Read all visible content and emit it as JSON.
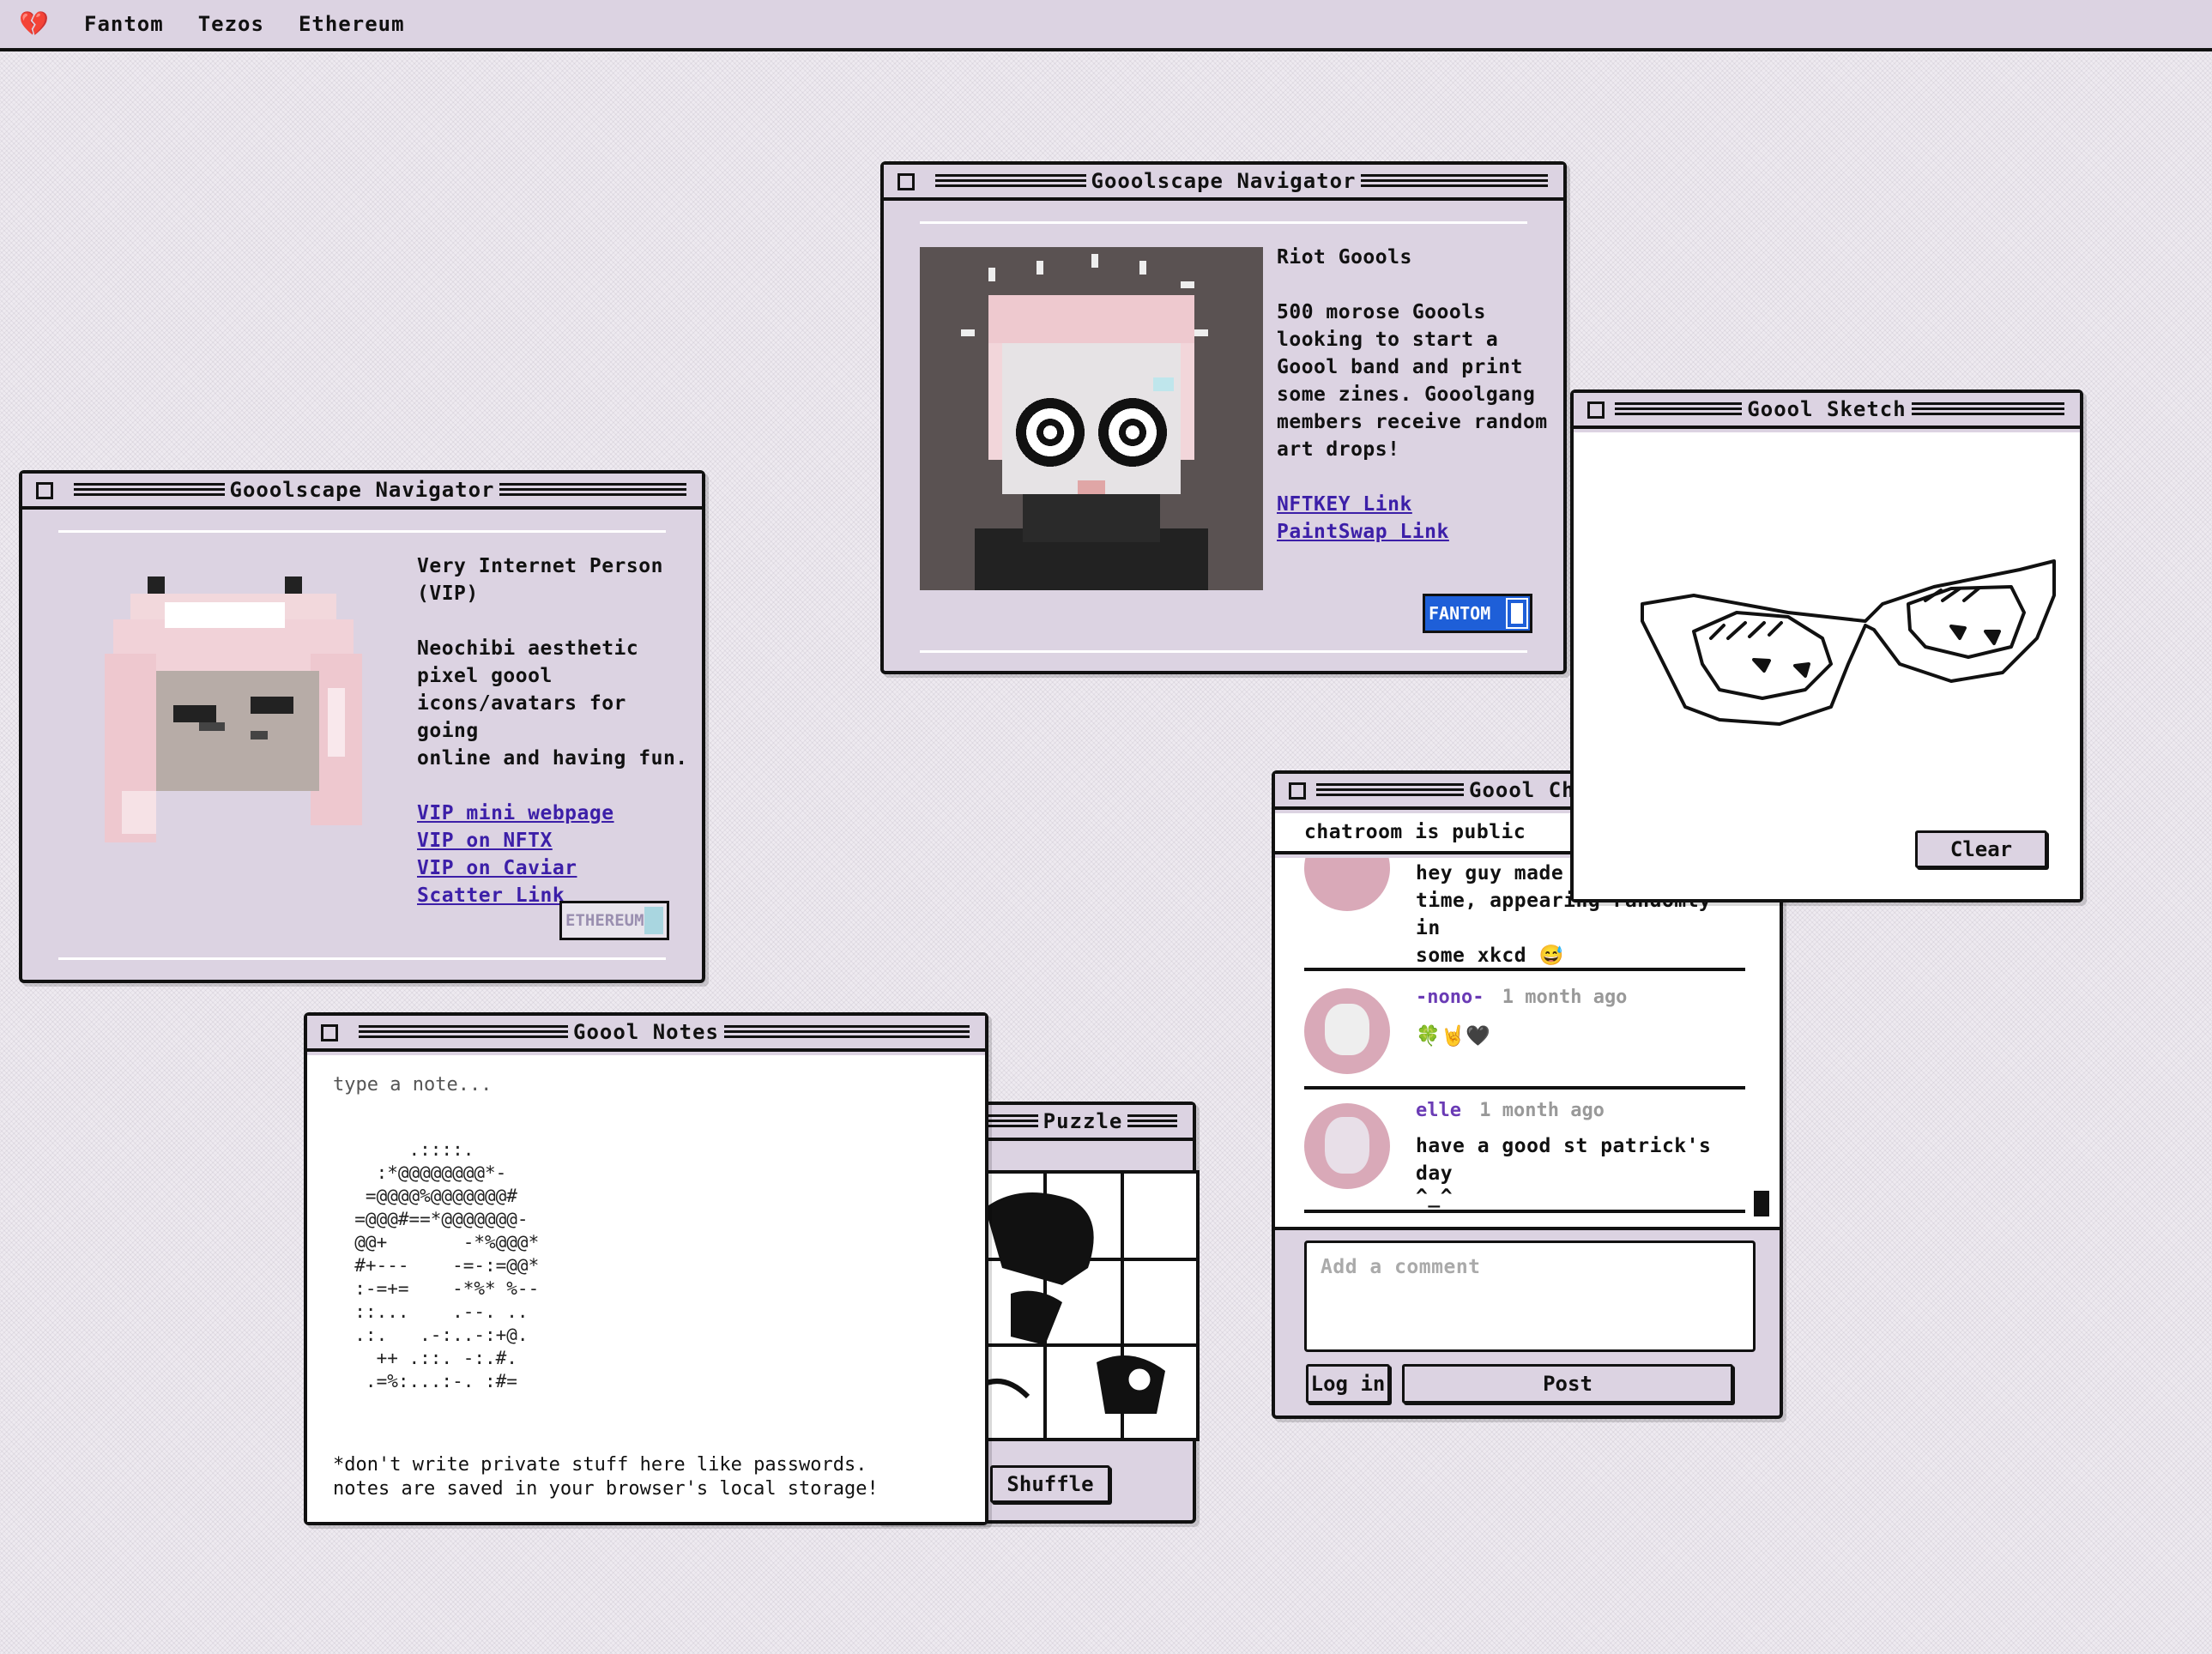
{
  "menubar": {
    "logo": "💔",
    "items": [
      "Fantom",
      "Tezos",
      "Ethereum"
    ]
  },
  "nav_left": {
    "title": "Gooolscape Navigator",
    "name_line1": "Very Internet Person",
    "name_line2": "(VIP)",
    "desc": [
      "Neochibi aesthetic",
      "pixel goool",
      "icons/avatars for going",
      "online and having fun."
    ],
    "links": [
      "VIP mini webpage",
      "VIP on NFTX",
      "VIP on Caviar",
      "Scatter Link"
    ],
    "badge": "ETHEREUM"
  },
  "nav_top": {
    "title": "Gooolscape Navigator",
    "name": "Riot Goools",
    "desc": [
      "500 morose Goools",
      "looking to start a",
      "Goool band and print",
      "some zines. Gooolgang",
      "members receive random",
      "art drops!"
    ],
    "links": [
      "NFTKEY Link",
      "PaintSwap Link"
    ],
    "badge": "FANTOM"
  },
  "sketch": {
    "title": "Goool Sketch",
    "clear": "Clear"
  },
  "chat": {
    "title": "Goool Ch",
    "status": "chatroom is public",
    "posts": [
      {
        "user": "",
        "time": "",
        "text": [
          "hey guy made",
          "time, appearing randomly in",
          "some xkcd 😅"
        ]
      },
      {
        "user": "-nono-",
        "time": "1 month ago",
        "text": [
          "🍀🤘🖤"
        ]
      },
      {
        "user": "elle",
        "time": "1 month ago",
        "text": [
          "have a good st patrick's day",
          "^_^"
        ]
      }
    ],
    "comment_placeholder": "Add a comment",
    "login": "Log in",
    "post": "Post"
  },
  "notes": {
    "title": "Goool Notes",
    "placeholder": "type a note...",
    "ascii": "       .::::.\n    :*@@@@@@@@*-\n   =@@@@%@@@@@@@#\n  =@@@#==*@@@@@@@-\n  @@+       -*%@@@*\n  #+---    -=-:=@@*\n  :-=+=    -*%* %--\n  ::...    .--. ..\n  .:.   .-:..-:+@.\n    ++ .::. -:.#.\n   .=%:...:-. :#=",
    "footer_line1": "*don't write private stuff here like passwords.",
    "footer_line2": "notes are saved in your browser's local storage!"
  },
  "puzzle": {
    "title": "Puzzle",
    "shuffle": "Shuffle"
  }
}
